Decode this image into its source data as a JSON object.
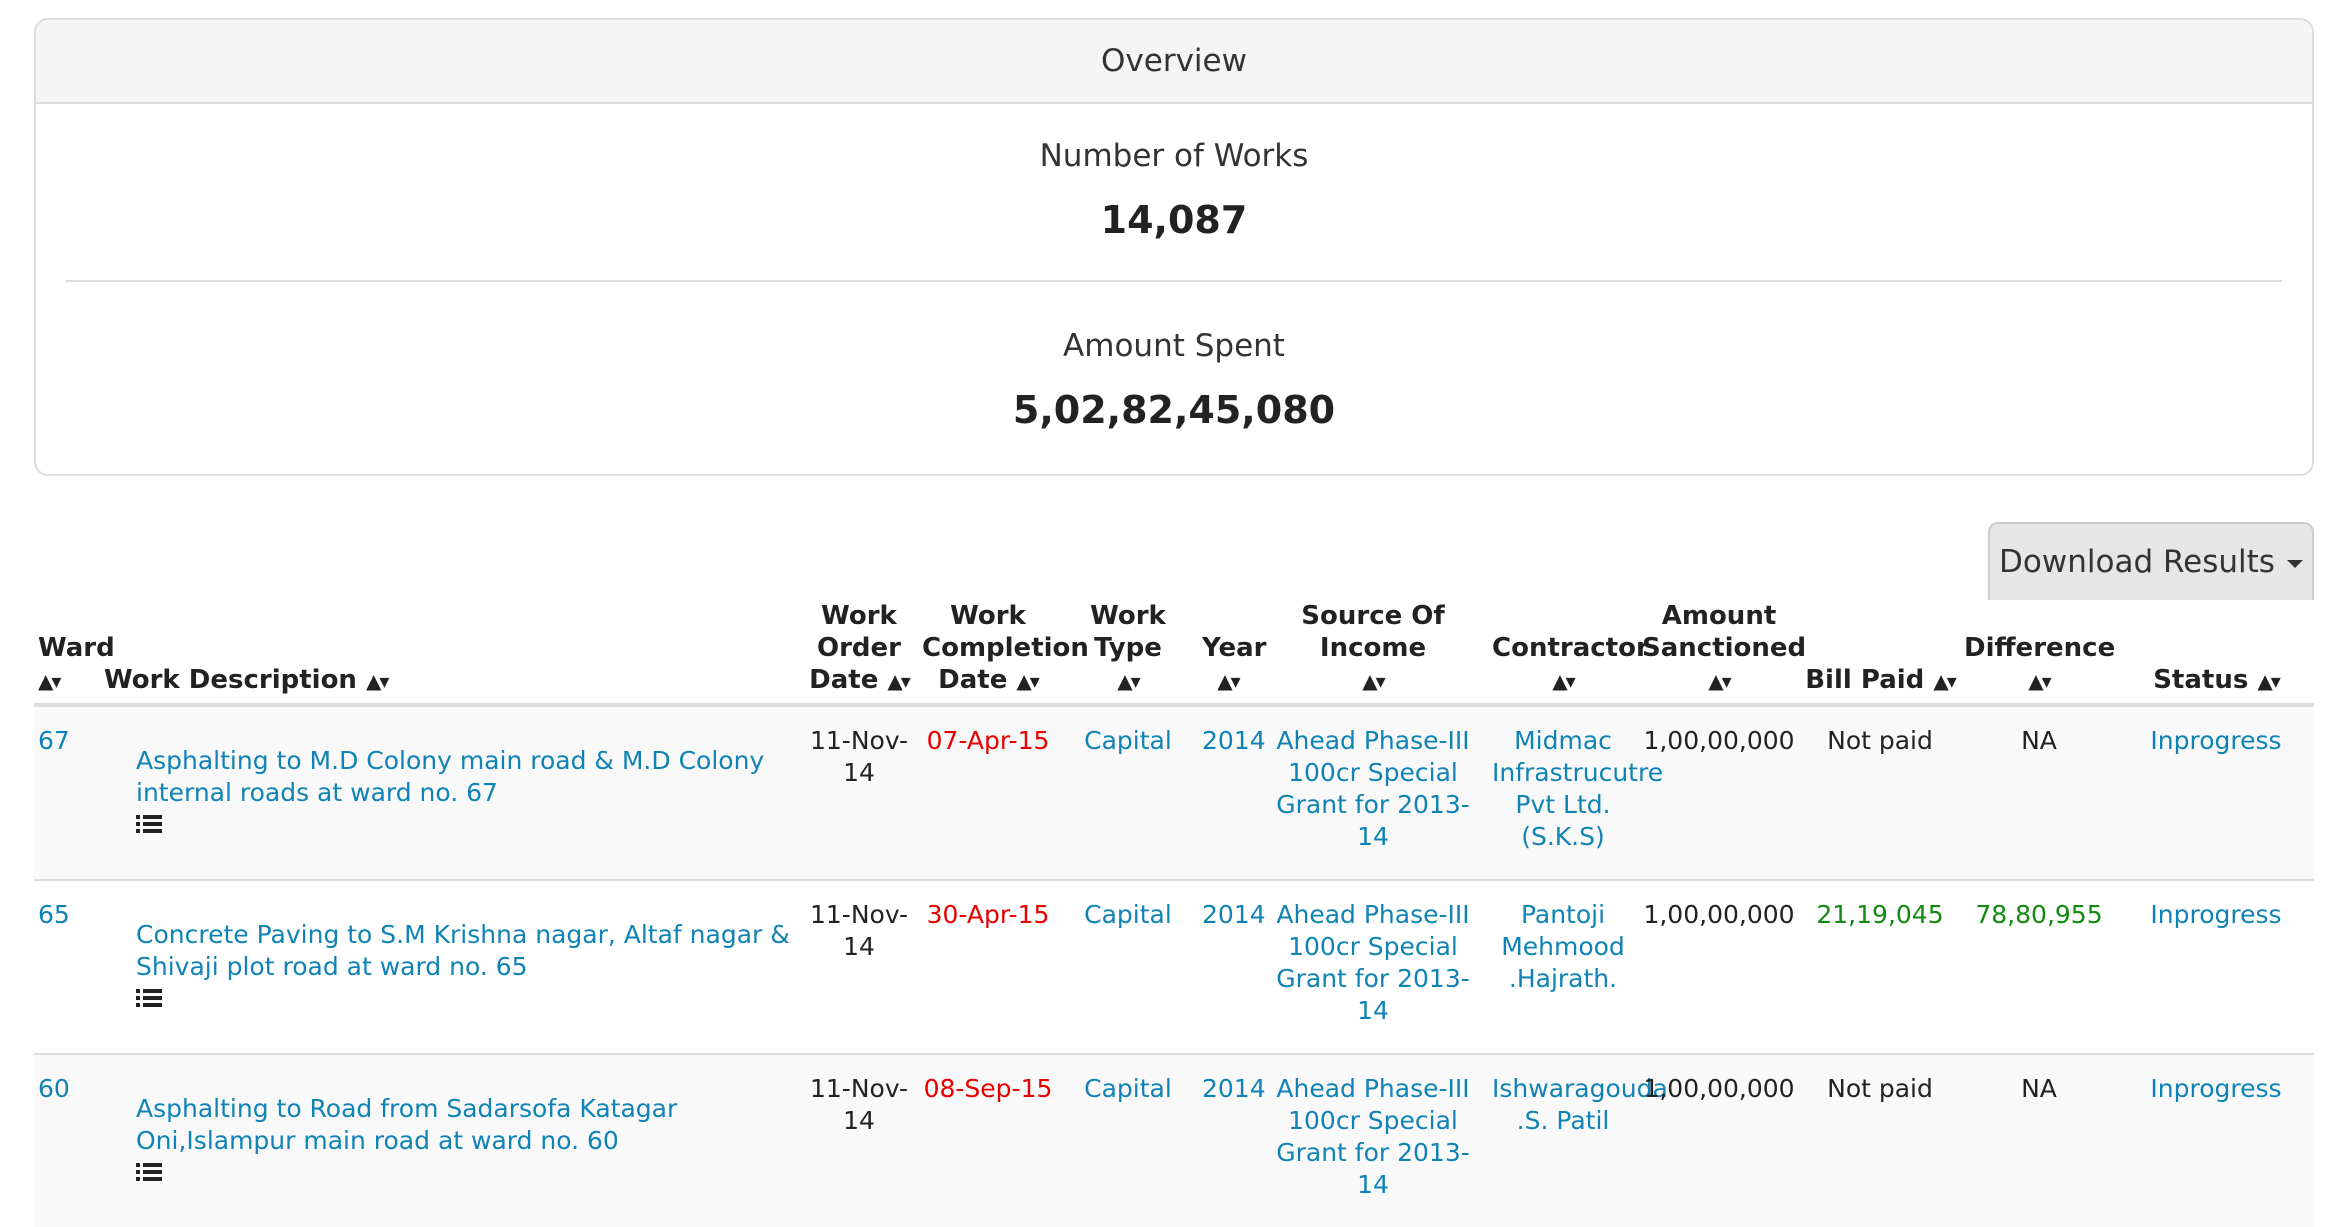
{
  "overview": {
    "heading": "Overview",
    "works_label": "Number of Works",
    "works_value": "14,087",
    "amount_label": "Amount Spent",
    "amount_value": "5,02,82,45,080"
  },
  "download_button": {
    "label": "Download Results"
  },
  "table": {
    "headers": {
      "ward": "Ward",
      "description": "Work Description",
      "order_date": "Work Order Date",
      "completion_date": "Work Completion Date",
      "work_type": "Work Type",
      "year": "Year",
      "source": "Source Of Income",
      "contractor": "Contractor",
      "amount": "Amount Sanctioned",
      "bill_paid": "Bill Paid",
      "difference": "Difference",
      "status": "Status"
    },
    "sort_glyph": "▲▾",
    "rows": [
      {
        "ward": "67",
        "description": "Asphalting to M.D Colony main road & M.D Colony internal roads at ward no. 67",
        "order_date": "11-Nov-14",
        "completion_date": "07-Apr-15",
        "work_type": "Capital",
        "year": "2014",
        "source": "Ahead Phase-III 100cr Special Grant for 2013-14",
        "contractor": "Midmac Infrastrucutre Pvt Ltd. (S.K.S)",
        "amount": "1,00,00,000",
        "bill_paid": "Not paid",
        "difference": "NA",
        "status": "Inprogress"
      },
      {
        "ward": "65",
        "description": "Concrete Paving to S.M Krishna nagar, Altaf nagar & Shivaji plot road at ward no. 65",
        "order_date": "11-Nov-14",
        "completion_date": "30-Apr-15",
        "work_type": "Capital",
        "year": "2014",
        "source": "Ahead Phase-III 100cr Special Grant for 2013-14",
        "contractor": "Pantoji Mehmood .Hajrath.",
        "amount": "1,00,00,000",
        "bill_paid": "21,19,045",
        "difference": "78,80,955",
        "status": "Inprogress"
      },
      {
        "ward": "60",
        "description": "Asphalting to Road from Sadarsofa Katagar Oni,Islampur main road at ward no. 60",
        "order_date": "11-Nov-14",
        "completion_date": "08-Sep-15",
        "work_type": "Capital",
        "year": "2014",
        "source": "Ahead Phase-III 100cr Special Grant for 2013-14",
        "contractor": "Ishwaragouda .S. Patil",
        "amount": "1,00,00,000",
        "bill_paid": "Not paid",
        "difference": "NA",
        "status": "Inprogress"
      }
    ]
  },
  "colors": {
    "link": "#0f83b6",
    "overdue_date": "#e60000",
    "paid": "#128a12",
    "border": "#dddddd"
  },
  "icons": {
    "details": "list-icon",
    "sort": "sort-arrows-icon",
    "dropdown": "caret-down-icon"
  }
}
